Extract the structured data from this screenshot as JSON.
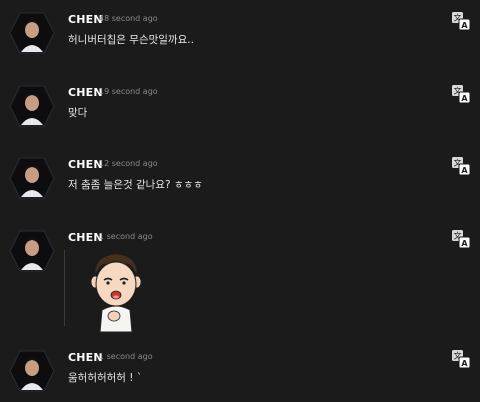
{
  "messages": [
    {
      "author": "CHEN",
      "time": "48 second ago",
      "text": "허니버터칩은 무슨맛일까요.."
    },
    {
      "author": "CHEN",
      "time": "19 second ago",
      "text": "맞다"
    },
    {
      "author": "CHEN",
      "time": "12 second ago",
      "text": "저 춤좀 늘은것 같나요? ㅎㅎㅎ"
    },
    {
      "author": "CHEN",
      "time": "1 second ago",
      "text": "",
      "sticker": "cartoon-face-sticker"
    },
    {
      "author": "CHEN",
      "time": "1 second ago",
      "text": "움허허허허허 ! `"
    }
  ],
  "icons": {
    "avatar": "hexagon-avatar",
    "translate": "translate-icon"
  },
  "colors": {
    "background": "#1b1b1c",
    "text": "#e6e6e6",
    "timestamp": "#8a8a8a"
  }
}
